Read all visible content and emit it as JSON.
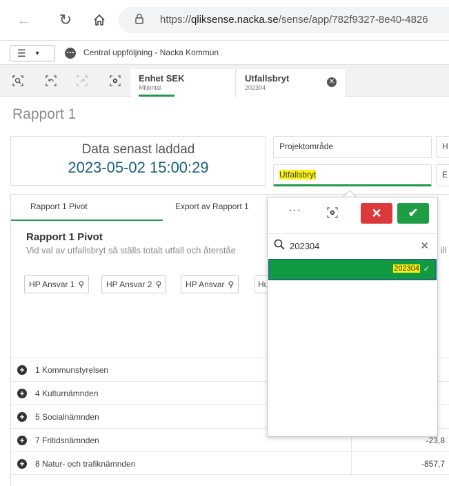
{
  "browser": {
    "url_prefix": "https://",
    "url_host": "qliksense.nacka.se",
    "url_path": "/sense/app/782f9327-8e40-4826"
  },
  "header": {
    "menu_icon": "hamburger-icon",
    "app_title": "Central uppföljning - Nacka Kommun"
  },
  "selections": [
    {
      "title": "Enhet SEK",
      "value": "Miljontal"
    },
    {
      "title": "Utfallsbryt",
      "value": "202304"
    }
  ],
  "page": {
    "title": "Rapport 1"
  },
  "kpi": {
    "label": "Data senast laddad",
    "value": "2023-05-02 15:00:29"
  },
  "filters": {
    "projektomrade": "Projektområde",
    "utfallsbryt": "Utfallsbryt",
    "right1": "H",
    "right2": "E"
  },
  "tabs": [
    {
      "label": "Rapport 1 Pivot"
    },
    {
      "label": "Export av Rapport 1"
    }
  ],
  "pivot": {
    "title": "Rapport 1 Pivot",
    "subtitle": "Vid val av utfallsbryt så ställs totalt utfall och återståe",
    "subtitle_tail": "ill c",
    "dimensions": [
      "HP Ansvar 1",
      "HP Ansvar 2",
      "HP Ansvar",
      "Hu"
    ],
    "rows": [
      {
        "label": "1 Kommunstyrelsen",
        "value": ""
      },
      {
        "label": "4 Kulturnämnden",
        "value": ""
      },
      {
        "label": "5 Socialnämnden",
        "value": ""
      },
      {
        "label": "7 Fritidsnämnden",
        "value": "-23,8"
      },
      {
        "label": "8 Natur- och trafiknämnden",
        "value": "-857,7"
      }
    ]
  },
  "dropdown": {
    "more": "···",
    "search_value": "202304",
    "items": [
      {
        "label": "202304",
        "selected": true
      }
    ]
  },
  "colors": {
    "green": "#1e9b46",
    "red": "#dc3a3a",
    "highlight": "#f8f20e",
    "kpi": "#1a5e7d"
  }
}
